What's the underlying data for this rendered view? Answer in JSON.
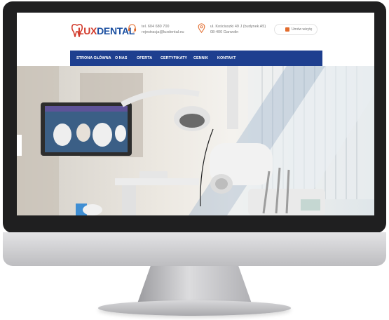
{
  "brand": {
    "part1": "LUX",
    "part2": "DENTAL",
    "red": "#d23a2b",
    "blue": "#1b4fa0"
  },
  "contact": {
    "phone_line": "tel. 604 680 700",
    "email_line": "rejestracja@luxdental.eu",
    "address_line1": "ul. Kościuszki 49 J (budynek A5)",
    "address_line2": "08-400 Garwolin",
    "accent": "#e26b2c"
  },
  "hours": {
    "text": "Umów wizytę"
  },
  "nav": {
    "color": "#1e3f8f",
    "items": [
      "STRONA GŁÓWNA",
      "O NAS",
      "OFERTA",
      "CERTYFIKATY",
      "CENNIK",
      "KONTAKT"
    ]
  }
}
